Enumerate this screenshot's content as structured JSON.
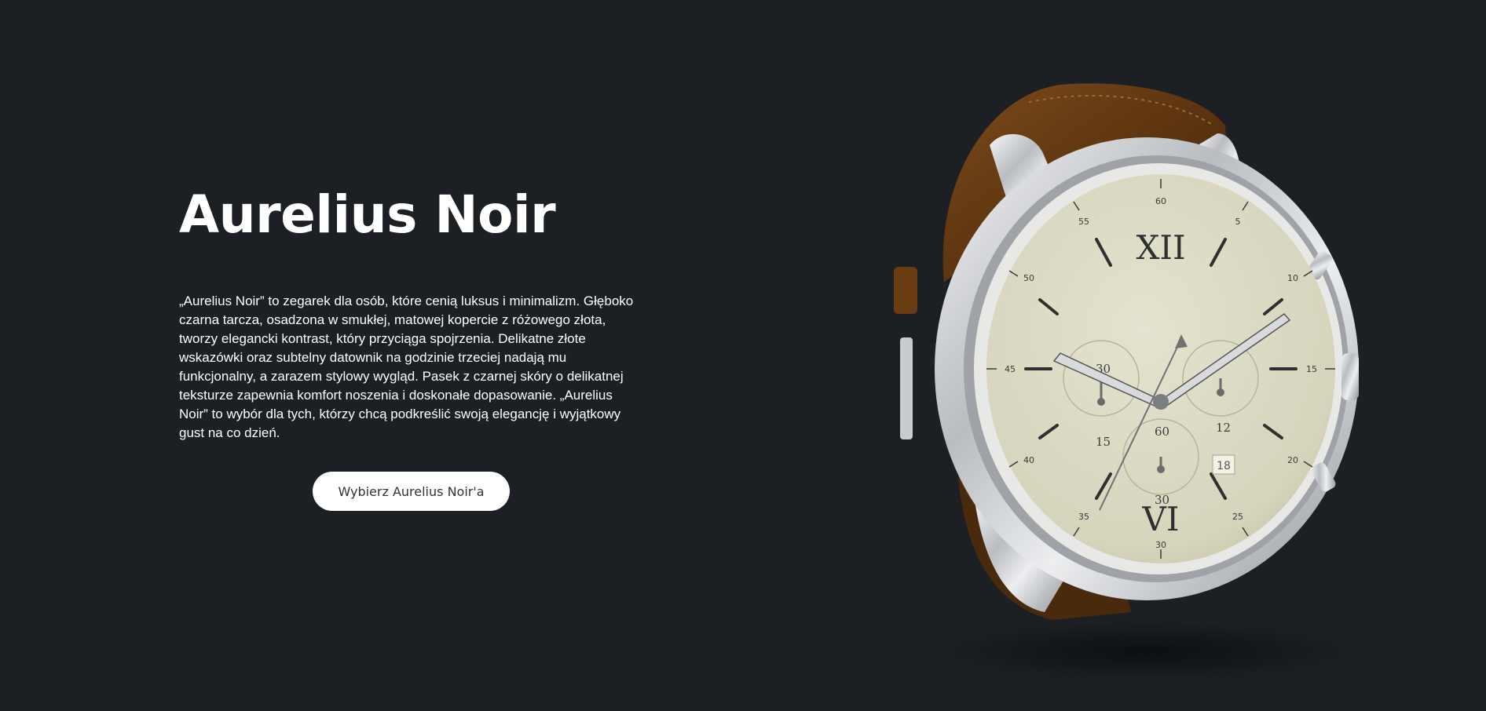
{
  "hero": {
    "title": "Aurelius Noir",
    "description": "„Aurelius Noir” to zegarek dla osób, które cenią luksus i minimalizm. Głęboko czarna tarcza, osadzona w smukłej, matowej kopercie z różowego złota, tworzy elegancki kontrast, który przyciąga spojrzenia. Delikatne złote wskazówki oraz subtelny datownik na godzinie trzeciej nadają mu funkcjonalny, a zarazem stylowy wygląd. Pasek z czarnej skóry o delikatnej teksturze zapewnia komfort noszenia i doskonałe dopasowanie. „Aurelius Noir” to wybór dla tych, którzy chcą podkreślić swoją elegancję i wyjątkowy gust na co dzień.",
    "cta_label": "Wybierz Aurelius Noir'a"
  },
  "watch": {
    "hour_numerals": {
      "top": "XII",
      "bottom": "VI"
    },
    "minute_marks": [
      "60",
      "5",
      "10",
      "15",
      "20",
      "25",
      "30",
      "35",
      "40",
      "45",
      "50",
      "55"
    ],
    "subdial_left_label": "15",
    "subdial_right_label": "12",
    "subdial_bottom_top_label": "60",
    "subdial_bottom_label": "30",
    "subdial_left_top_label": "30",
    "date_value": "18"
  },
  "colors": {
    "background": "#1c2024",
    "dial": "#dcdbc4",
    "strap": "#6b3e12",
    "case": "#c7c9cc",
    "button_bg": "#ffffff",
    "button_text": "#333333"
  }
}
